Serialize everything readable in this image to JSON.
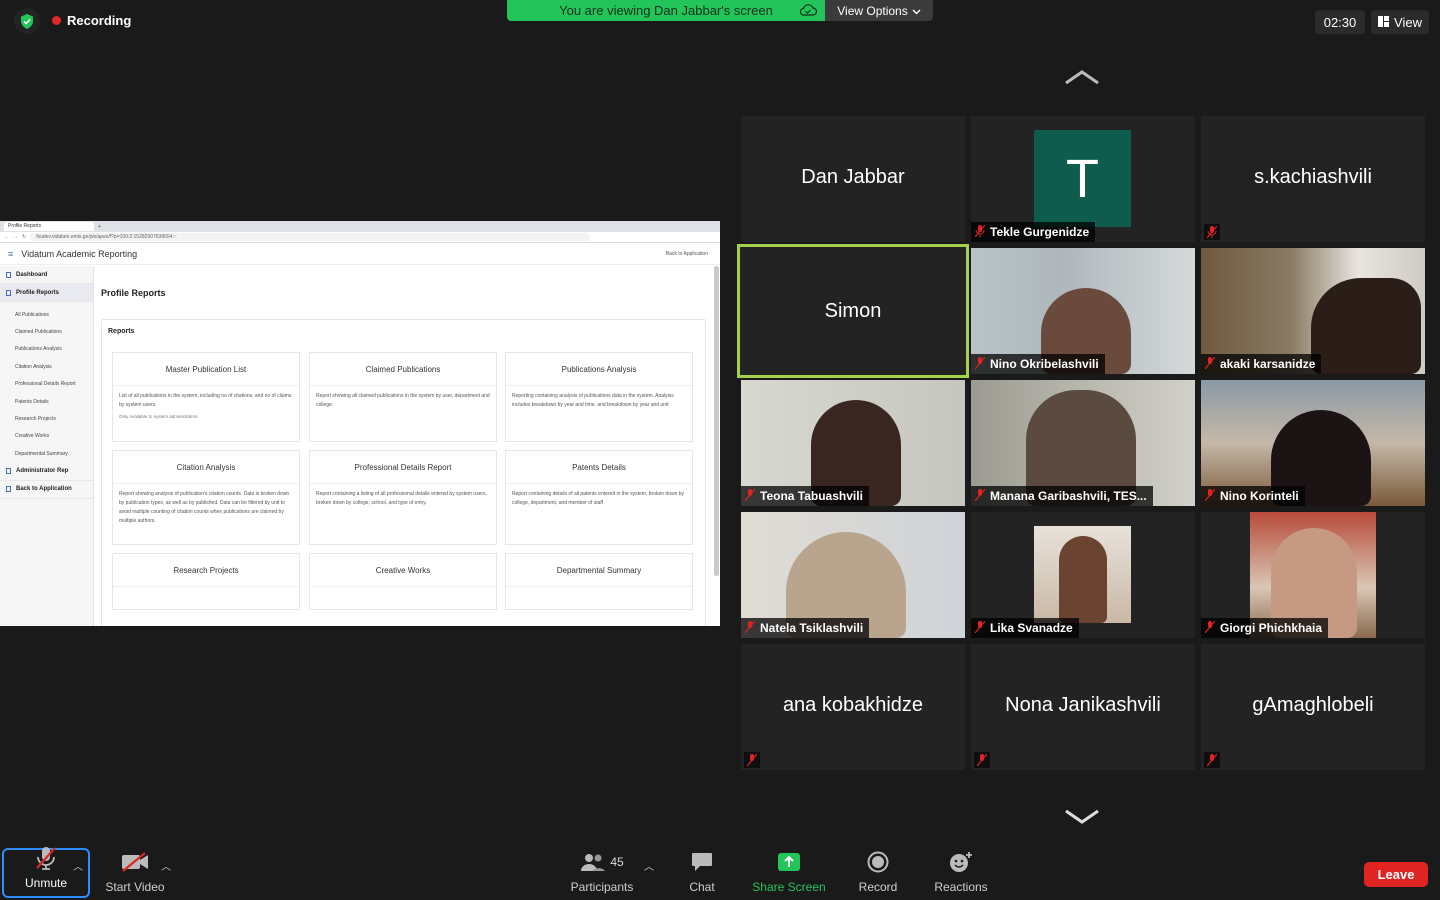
{
  "top": {
    "recording_label": "Recording",
    "viewing_banner": "You are viewing Dan Jabbar's screen",
    "view_options_label": "View Options",
    "timer": "02:30",
    "view_label": "View"
  },
  "shared_screen": {
    "browser_tab": "Profile Reports",
    "url": "fsudev.vidatum.emis.ge/pls/apex/f?p=100:2:15282907638654:::",
    "app_title": "Vidatum Academic Reporting",
    "back_link": "Back to Application",
    "page_title": "Profile Reports",
    "reports_label": "Reports",
    "sidebar": {
      "dashboard": "Dashboard",
      "profile_reports": "Profile Reports",
      "sub_items": [
        "All Publications",
        "Claimed Publications",
        "Publications Analysis",
        "Citation Analysis",
        "Professional Details Report",
        "Patents Details",
        "Research Projects",
        "Creative Works",
        "Departmental Summary"
      ],
      "administrator": "Administrator Rep",
      "back": "Back to Application"
    },
    "cards": [
      {
        "title": "Master Publication List",
        "desc": "List of all publications in the system, including no of citations, and no of claims by system users.",
        "note": "Only Available to system administrators"
      },
      {
        "title": "Claimed Publications",
        "desc": "Report showing all claimed publications in the system by user, department and college.",
        "note": ""
      },
      {
        "title": "Publications Analysis",
        "desc": "Reporting containing analysis of publications data in the system. Analysis includes breakdown by year and time, and breakdown by year and unit",
        "note": ""
      },
      {
        "title": "Citation Analysis",
        "desc": "Report showing analysis of publication's citation counts. Data is broken down by publication types, as well as by published. Data can be filtered by unit to avoid multiple counting of citation counts when publications are claimed by multiple authors.",
        "note": ""
      },
      {
        "title": "Professional Details Report",
        "desc": "Report containing a listing of all professional details entered by system users, broken down by college, school, and type of entry.",
        "note": ""
      },
      {
        "title": "Patents Details",
        "desc": "Report containing details of all patents entered in the system, broken down by college, department, and member of staff",
        "note": ""
      },
      {
        "title": "Research Projects",
        "desc": "",
        "note": ""
      },
      {
        "title": "Creative Works",
        "desc": "",
        "note": ""
      },
      {
        "title": "Departmental Summary",
        "desc": "",
        "note": ""
      }
    ]
  },
  "participants": [
    {
      "name": "Dan Jabbar",
      "label": ""
    },
    {
      "name": "",
      "label": "Tekle Gurgenidze",
      "avatar_letter": "T"
    },
    {
      "name": "s.kachiashvili",
      "label": ""
    },
    {
      "name": "Simon",
      "label": ""
    },
    {
      "name": "",
      "label": "Nino Okribelashvili"
    },
    {
      "name": "",
      "label": "akaki karsanidze"
    },
    {
      "name": "",
      "label": "Teona Tabuashvili"
    },
    {
      "name": "",
      "label": "Manana Garibashvili, TES..."
    },
    {
      "name": "",
      "label": "Nino Korinteli"
    },
    {
      "name": "",
      "label": "Natela Tsiklashvili"
    },
    {
      "name": "",
      "label": "Lika Svanadze"
    },
    {
      "name": "",
      "label": "Giorgi Phichkhaia"
    },
    {
      "name": "ana kobakhidze",
      "label": ""
    },
    {
      "name": "Nona Janikashvili",
      "label": ""
    },
    {
      "name": "gAmaghlobeli",
      "label": ""
    }
  ],
  "toolbar": {
    "unmute": "Unmute",
    "start_video": "Start Video",
    "participants": "Participants",
    "participants_count": "45",
    "chat": "Chat",
    "share_screen": "Share Screen",
    "record": "Record",
    "reactions": "Reactions",
    "leave": "Leave"
  },
  "colors": {
    "banner_green": "#23c45a",
    "speaker_outline": "#a5d14a",
    "leave_red": "#e02424",
    "share_green": "#23c45a",
    "avatar_teal": "#0d5c4e"
  }
}
